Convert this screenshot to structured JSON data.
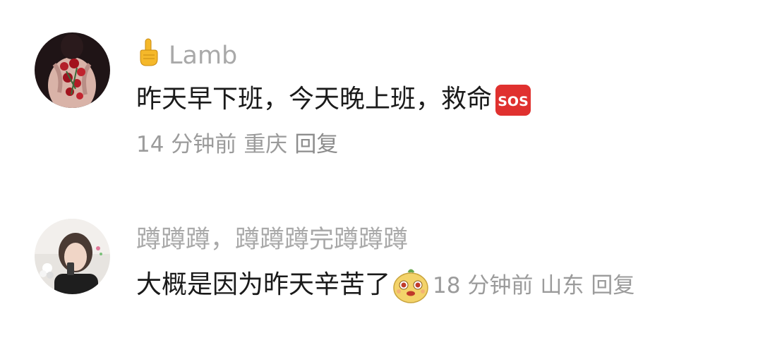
{
  "comments": [
    {
      "user": "Lamb",
      "text": "昨天早下班，今天晚上班，救命",
      "time": "14 分钟前",
      "location": "重庆",
      "reply_label": "回复",
      "emoji": "sos-icon",
      "user_icon": "pointing-up-hand-icon"
    },
    {
      "user": "蹲蹲蹲，蹲蹲蹲完蹲蹲蹲",
      "text": "大概是因为昨天辛苦了",
      "time": "18 分钟前",
      "location": "山东",
      "reply_label": "回复",
      "emoji": "sticker-face-icon"
    }
  ],
  "colors": {
    "username": "#a9a9a9",
    "text": "#1a1a1a",
    "meta": "#9b9b9b",
    "sos": "#e0312f"
  }
}
